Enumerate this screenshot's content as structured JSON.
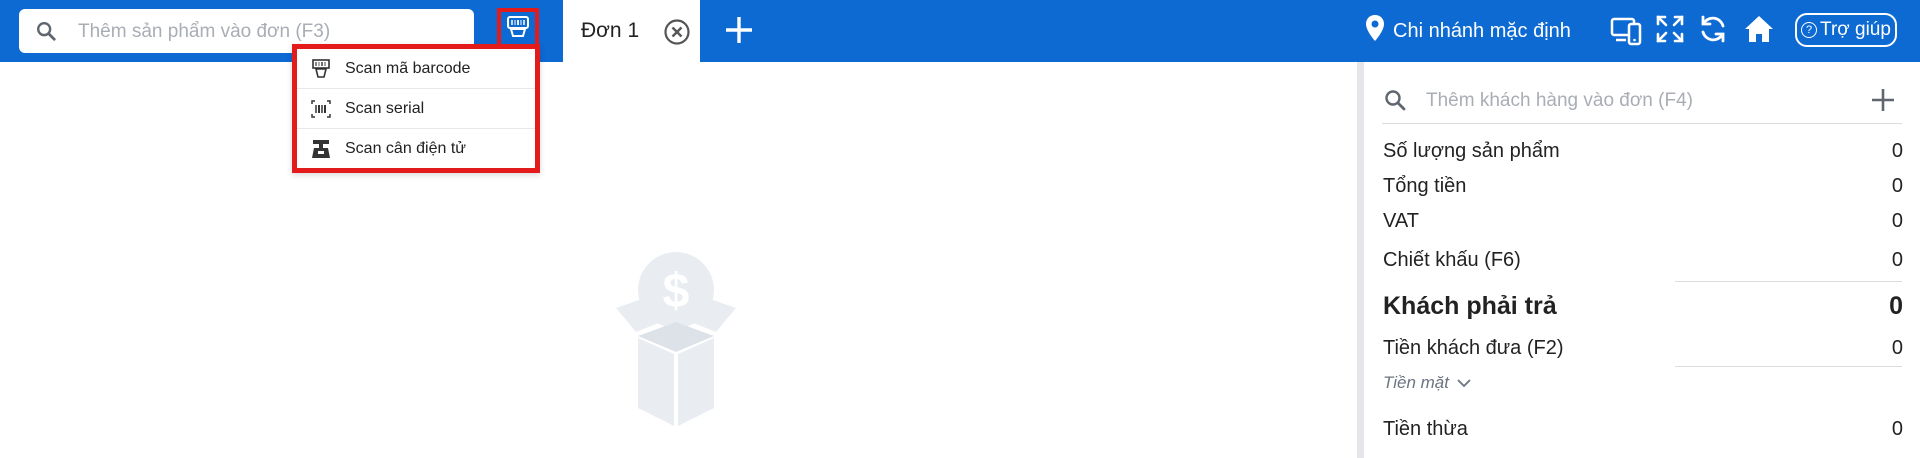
{
  "colors": {
    "header_bg": "#0d6ad3",
    "highlight": "#e31b1b",
    "sidebar_sep": "#e4e6ea"
  },
  "header": {
    "search": {
      "placeholder": "Thêm sản phẩm vào đơn (F3)",
      "value": "",
      "icon": "search-icon"
    },
    "scan_toggle": {
      "icon": "barcode-scanner-icon"
    },
    "tabs": [
      {
        "label": "Đơn 1",
        "close_icon": "close-circle-icon"
      }
    ],
    "add_tab_icon": "plus-icon",
    "branch": {
      "label": "Chi nhánh mặc định",
      "icon": "location-pin-icon"
    },
    "tools": [
      "devices-icon",
      "fullscreen-icon",
      "refresh-icon",
      "home-icon"
    ],
    "help": {
      "label": "Trợ giúp",
      "icon": "question-circle-icon"
    }
  },
  "scan_menu": {
    "items": [
      {
        "label": "Scan mã barcode",
        "icon": "barcode-scanner-icon"
      },
      {
        "label": "Scan serial",
        "icon": "serial-barcode-icon"
      },
      {
        "label": "Scan cân điện tử",
        "icon": "electronic-scale-icon"
      }
    ]
  },
  "empty_state": {
    "icon": "empty-box-money-icon"
  },
  "sidebar": {
    "customer_search": {
      "placeholder": "Thêm khách hàng vào đơn (F4)",
      "value": "",
      "icon": "search-icon",
      "add_icon": "plus-icon"
    },
    "summary": {
      "product_count": {
        "label": "Số lượng sản phẩm",
        "value": "0"
      },
      "total": {
        "label": "Tổng tiền",
        "value": "0"
      },
      "vat": {
        "label": "VAT",
        "value": "0"
      },
      "discount": {
        "label": "Chiết khấu (F6)",
        "value": "0"
      },
      "customer_pay": {
        "label": "Khách phải trả",
        "value": "0"
      },
      "customer_given": {
        "label": "Tiền khách đưa (F2)",
        "value": "0"
      },
      "payment_method": {
        "label": "Tiền mặt"
      },
      "change": {
        "label": "Tiền thừa",
        "value": "0"
      }
    }
  }
}
